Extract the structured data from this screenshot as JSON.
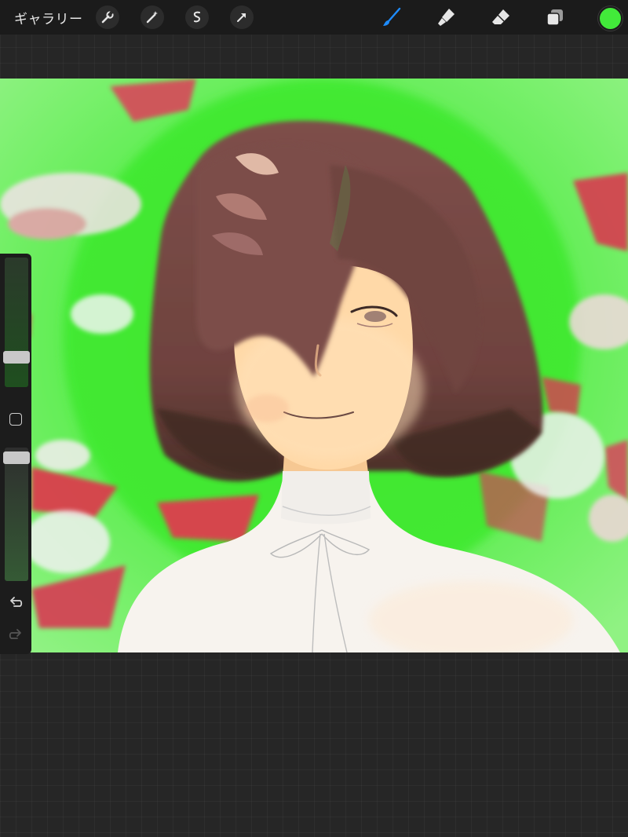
{
  "app": {
    "gallery_label": "ギャラリー"
  },
  "toolbar": {
    "left_tools": [
      "wrench-icon",
      "magic-wand-icon",
      "selection-icon",
      "transform-arrow-icon"
    ],
    "right_tools": [
      "brush-icon",
      "smudge-icon",
      "eraser-icon",
      "layers-icon"
    ],
    "active_tool": "brush-icon",
    "active_color": "#42ea3a",
    "accent_color": "#1e8cff"
  },
  "sidebar": {
    "brush_size_level": 0.8,
    "opacity_level": 0.05,
    "controls": [
      "size-slider",
      "modifier-button",
      "opacity-slider",
      "undo-icon",
      "redo-icon"
    ]
  },
  "canvas": {
    "background_color": "#44ee33",
    "hair_color": "#7a4b47",
    "skin_color": "#ffd9a8",
    "shirt_color": "#f7f3ee"
  }
}
